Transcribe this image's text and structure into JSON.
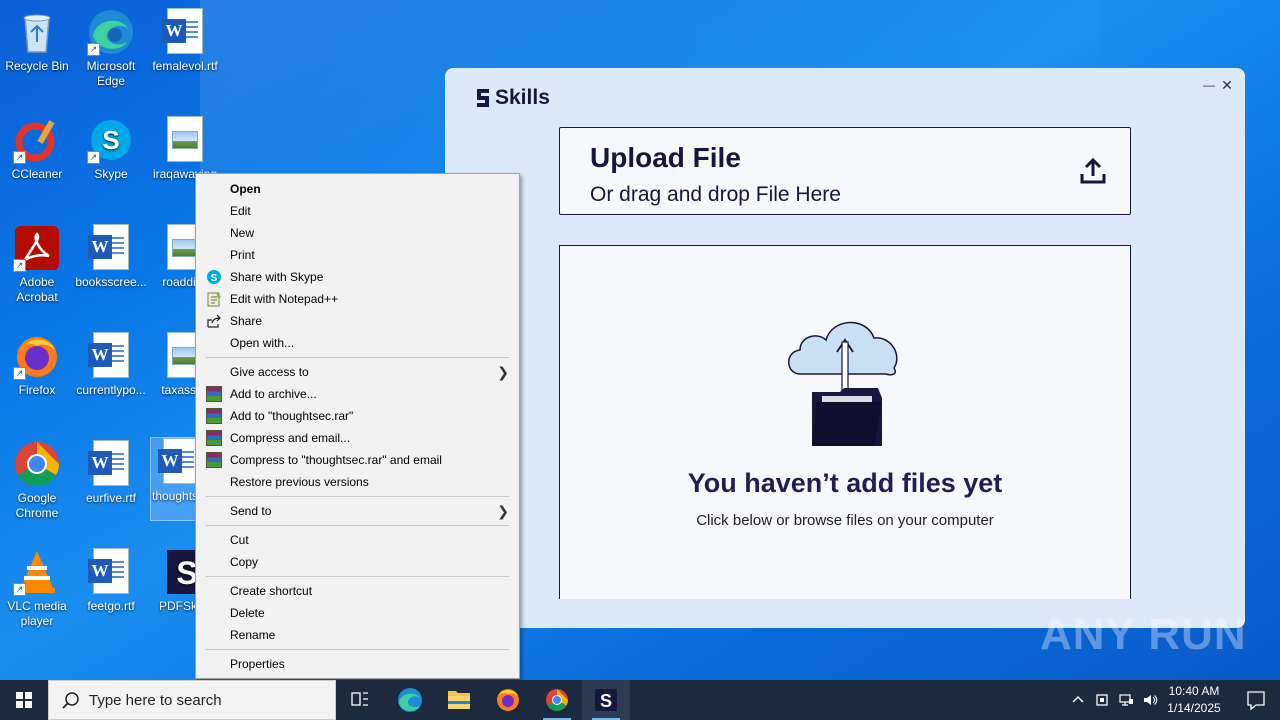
{
  "desktop": {
    "icons": [
      {
        "label": "Recycle Bin"
      },
      {
        "label": "Microsoft Edge"
      },
      {
        "label": "femalevol.rtf"
      },
      {
        "label": "CCleaner"
      },
      {
        "label": "Skype"
      },
      {
        "label": "iraqawaying"
      },
      {
        "label": "Adobe Acrobat"
      },
      {
        "label": "booksscree..."
      },
      {
        "label": "roaddisc"
      },
      {
        "label": "Firefox"
      },
      {
        "label": "currentlypo..."
      },
      {
        "label": "taxassoc"
      },
      {
        "label": "Google Chrome"
      },
      {
        "label": "eurfive.rtf"
      },
      {
        "label": "thoughtsec.rtf"
      },
      {
        "label": "VLC media player"
      },
      {
        "label": "feetgo.rtf"
      },
      {
        "label": "PDFSkills"
      }
    ]
  },
  "skills": {
    "logo_text": "Skills",
    "minimize_glyph": "—",
    "close_glyph": "✕",
    "upload_title": "Upload File",
    "upload_subtitle": "Or drag and drop File Here",
    "empty_title": "You haven’t add files yet",
    "empty_subtitle": "Click below or browse files on your computer"
  },
  "context_menu": {
    "items": [
      {
        "label": "Open"
      },
      {
        "label": "Edit"
      },
      {
        "label": "New"
      },
      {
        "label": "Print"
      },
      {
        "label": "Share with Skype"
      },
      {
        "label": "Edit with Notepad++"
      },
      {
        "label": "Share"
      },
      {
        "label": "Open with..."
      },
      {
        "label": "Give access to"
      },
      {
        "label": "Add to archive..."
      },
      {
        "label": "Add to \"thoughtsec.rar\""
      },
      {
        "label": "Compress and email..."
      },
      {
        "label": "Compress to \"thoughtsec.rar\" and email"
      },
      {
        "label": "Restore previous versions"
      },
      {
        "label": "Send to"
      },
      {
        "label": "Cut"
      },
      {
        "label": "Copy"
      },
      {
        "label": "Create shortcut"
      },
      {
        "label": "Delete"
      },
      {
        "label": "Rename"
      },
      {
        "label": "Properties"
      }
    ]
  },
  "taskbar": {
    "search_placeholder": "Type here to search",
    "time": "10:40 AM",
    "date": "1/14/2025",
    "apps": [
      "task-view",
      "edge",
      "file-explorer",
      "firefox",
      "chrome",
      "pdfskills"
    ]
  },
  "watermark": "ANY RUN",
  "colors": {
    "skills_navy": "#16163e",
    "skills_bg": "#dce9f8",
    "taskbar": "#1c2a3e"
  }
}
